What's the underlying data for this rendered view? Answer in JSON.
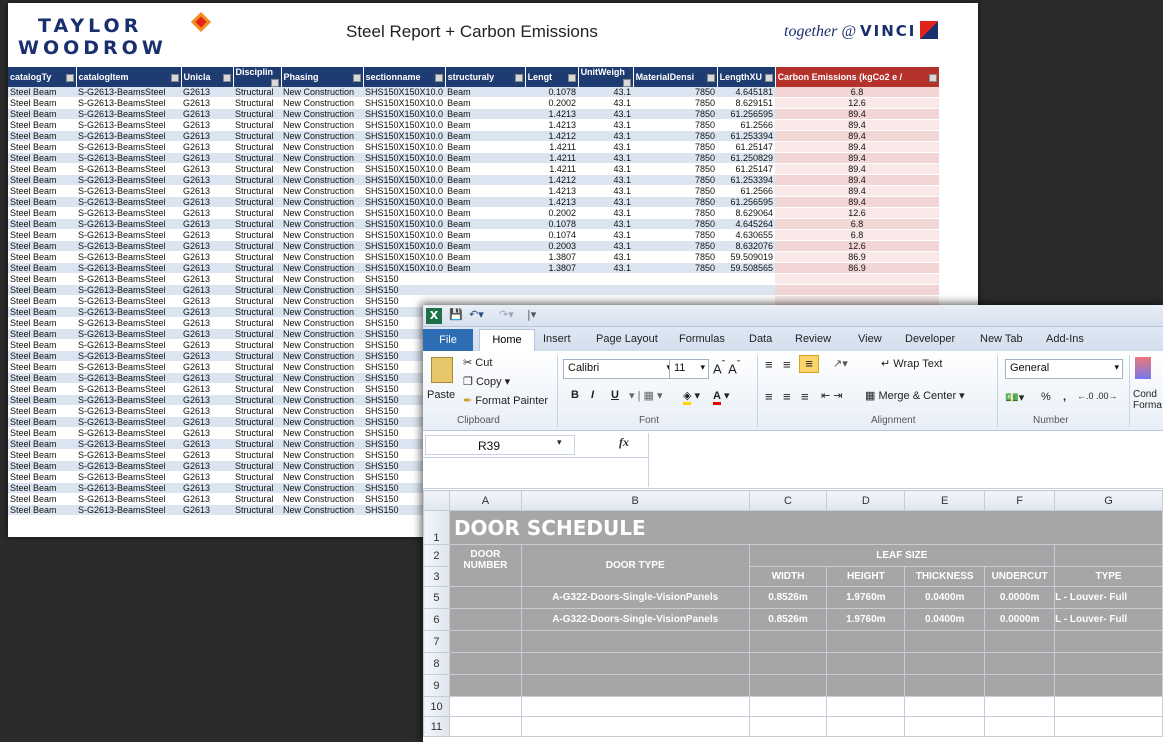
{
  "steel": {
    "logo_left_line1": "TAYLOR",
    "logo_left_line2": "WOODROW",
    "title": "Steel Report + Carbon Emissions",
    "logo_right_text": "together @",
    "logo_right_brand": "VINCI",
    "headers": [
      "catalogTy",
      "catalogItem",
      "Unicla",
      "Disciplin",
      "Phasing",
      "sectionname",
      "structuraly",
      "Lengt",
      "UnitWeigh",
      "MaterialDensi",
      "LengthXU",
      "Carbon Emissions (kgCo2 e /"
    ],
    "constant": {
      "type": "Steel Beam",
      "item": "S-G2613-BeamsSteel",
      "unicla": "G2613",
      "discipline": "Structural",
      "phasing": "New Construction",
      "section": "SHS150X150X10.0",
      "section_short": "SHS150",
      "struct": "Beam",
      "unit_weight": "43.1",
      "density": "7850"
    },
    "rows": [
      {
        "len": "0.1078",
        "lx": "4.645181",
        "em": "6.8"
      },
      {
        "len": "0.2002",
        "lx": "8.629151",
        "em": "12.6"
      },
      {
        "len": "1.4213",
        "lx": "61.256595",
        "em": "89.4"
      },
      {
        "len": "1.4213",
        "lx": "61.2566",
        "em": "89.4"
      },
      {
        "len": "1.4212",
        "lx": "61.253394",
        "em": "89.4"
      },
      {
        "len": "1.4211",
        "lx": "61.25147",
        "em": "89.4"
      },
      {
        "len": "1.4211",
        "lx": "61.250829",
        "em": "89.4"
      },
      {
        "len": "1.4211",
        "lx": "61.25147",
        "em": "89.4"
      },
      {
        "len": "1.4212",
        "lx": "61.253394",
        "em": "89.4"
      },
      {
        "len": "1.4213",
        "lx": "61.2566",
        "em": "89.4"
      },
      {
        "len": "1.4213",
        "lx": "61.256595",
        "em": "89.4"
      },
      {
        "len": "0.2002",
        "lx": "8.629064",
        "em": "12.6"
      },
      {
        "len": "0.1078",
        "lx": "4.645264",
        "em": "6.8"
      },
      {
        "len": "0.1074",
        "lx": "4.630655",
        "em": "6.8"
      },
      {
        "len": "0.2003",
        "lx": "8.632076",
        "em": "12.6"
      },
      {
        "len": "1.3807",
        "lx": "59.509019",
        "em": "86.9"
      },
      {
        "len": "1.3807",
        "lx": "59.508565",
        "em": "86.9"
      }
    ],
    "extra_rows": 22
  },
  "excel": {
    "qat_icons": [
      "excel-logo",
      "save-icon",
      "undo-icon",
      "redo-icon"
    ],
    "tabs": [
      "File",
      "Home",
      "Insert",
      "Page Layout",
      "Formulas",
      "Data",
      "Review",
      "View",
      "Developer",
      "New Tab",
      "Add-Ins"
    ],
    "clipboard": {
      "paste": "Paste",
      "cut": "Cut",
      "copy": "Copy",
      "format_painter": "Format Painter",
      "label": "Clipboard"
    },
    "font": {
      "name": "Calibri",
      "size": "11",
      "bold": "B",
      "italic": "I",
      "underline": "U",
      "label": "Font"
    },
    "alignment": {
      "wrap": "Wrap Text",
      "merge": "Merge & Center",
      "label": "Alignment"
    },
    "number": {
      "format": "General",
      "percent": "%",
      "comma": ",",
      "label": "Number"
    },
    "cond": "Cond\nForma",
    "name_box": "R39",
    "fx": "fx",
    "columns": [
      "A",
      "B",
      "C",
      "D",
      "E",
      "F",
      "G"
    ],
    "title": "DOOR SCHEDULE",
    "door_number": "DOOR\nNUMBER",
    "door_type": "DOOR TYPE",
    "leaf_size": "LEAF SIZE",
    "sub_headers": [
      "WIDTH",
      "HEIGHT",
      "THICKNESS",
      "UNDERCUT",
      "TYPE"
    ],
    "rows": [
      {
        "num": "5",
        "type": "A-G322-Doors-Single-VisionPanels",
        "width": "0.8526m",
        "height": "1.9760m",
        "thickness": "0.0400m",
        "undercut": "0.0000m",
        "ltype": "L - Louver- Full"
      },
      {
        "num": "6",
        "type": "A-G322-Doors-Single-VisionPanels",
        "width": "0.8526m",
        "height": "1.9760m",
        "thickness": "0.0400m",
        "undercut": "0.0000m",
        "ltype": "L - Louver- Full"
      }
    ],
    "empty_rows": [
      "7",
      "8",
      "9"
    ],
    "blank_rows": [
      "10",
      "11"
    ],
    "row_nums": [
      "1",
      "2",
      "3"
    ]
  }
}
